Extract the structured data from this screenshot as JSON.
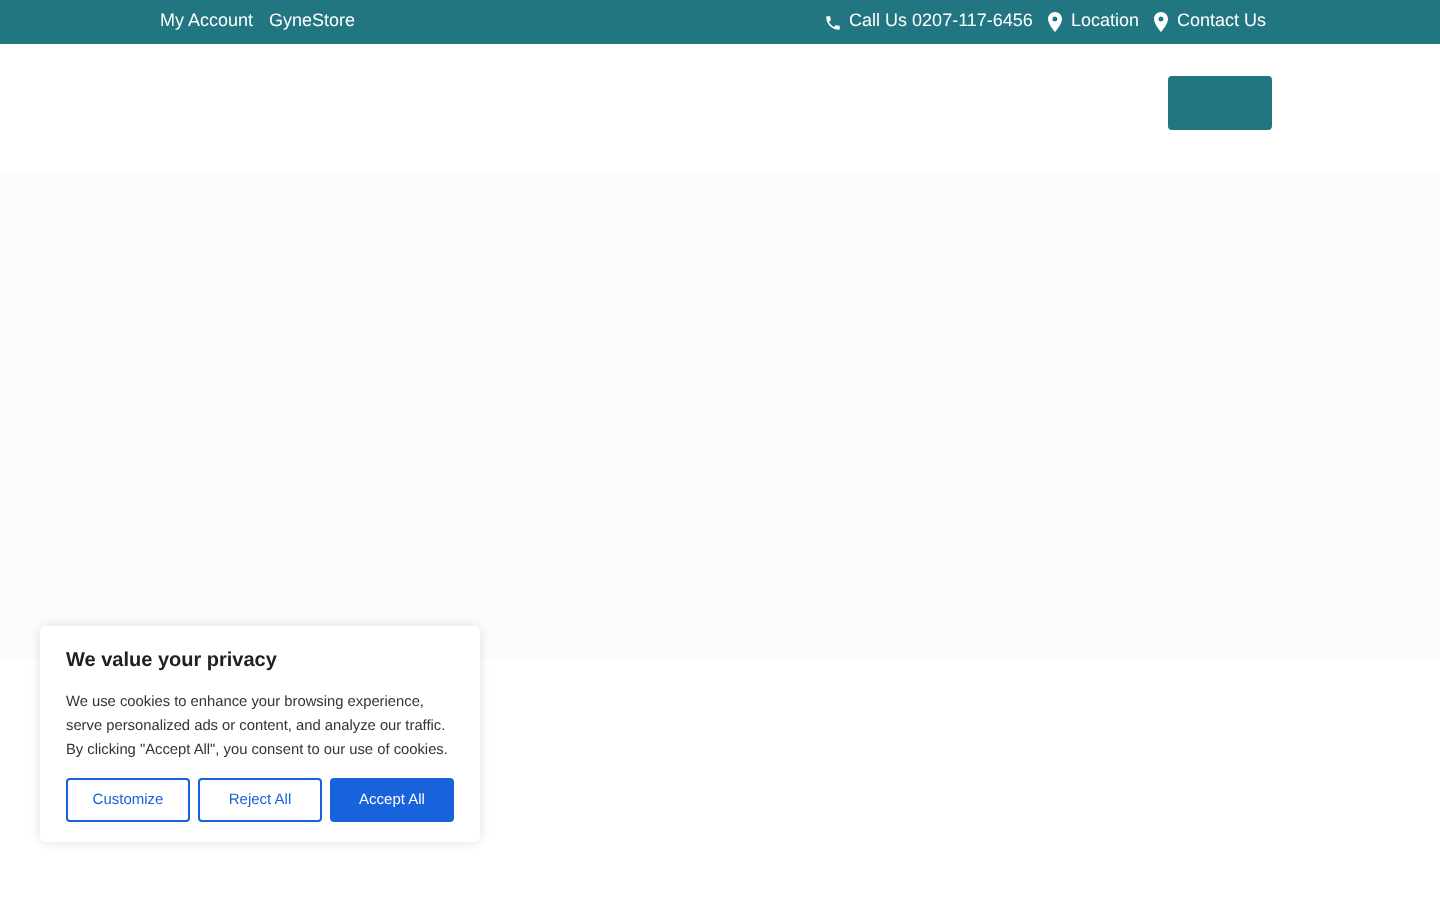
{
  "top_bar": {
    "left_links": [
      "My Account",
      "GyneStore"
    ],
    "right_links": [
      {
        "label": "Call Us 0207-117-6456",
        "kind": "phone"
      },
      {
        "label": "Location",
        "kind": "pin"
      },
      {
        "label": "Contact Us",
        "kind": "pin"
      }
    ]
  },
  "cookie_banner": {
    "title": "We value your privacy",
    "text": "We use cookies to enhance your browsing experience, serve personalized ads or content, and analyze our traffic. By clicking \"Accept All\", you consent to our use of cookies.",
    "buttons": [
      {
        "label": "Customize",
        "kind": "outline"
      },
      {
        "label": "Reject All",
        "kind": "outline"
      },
      {
        "label": "Accept All",
        "kind": "primary"
      }
    ]
  }
}
